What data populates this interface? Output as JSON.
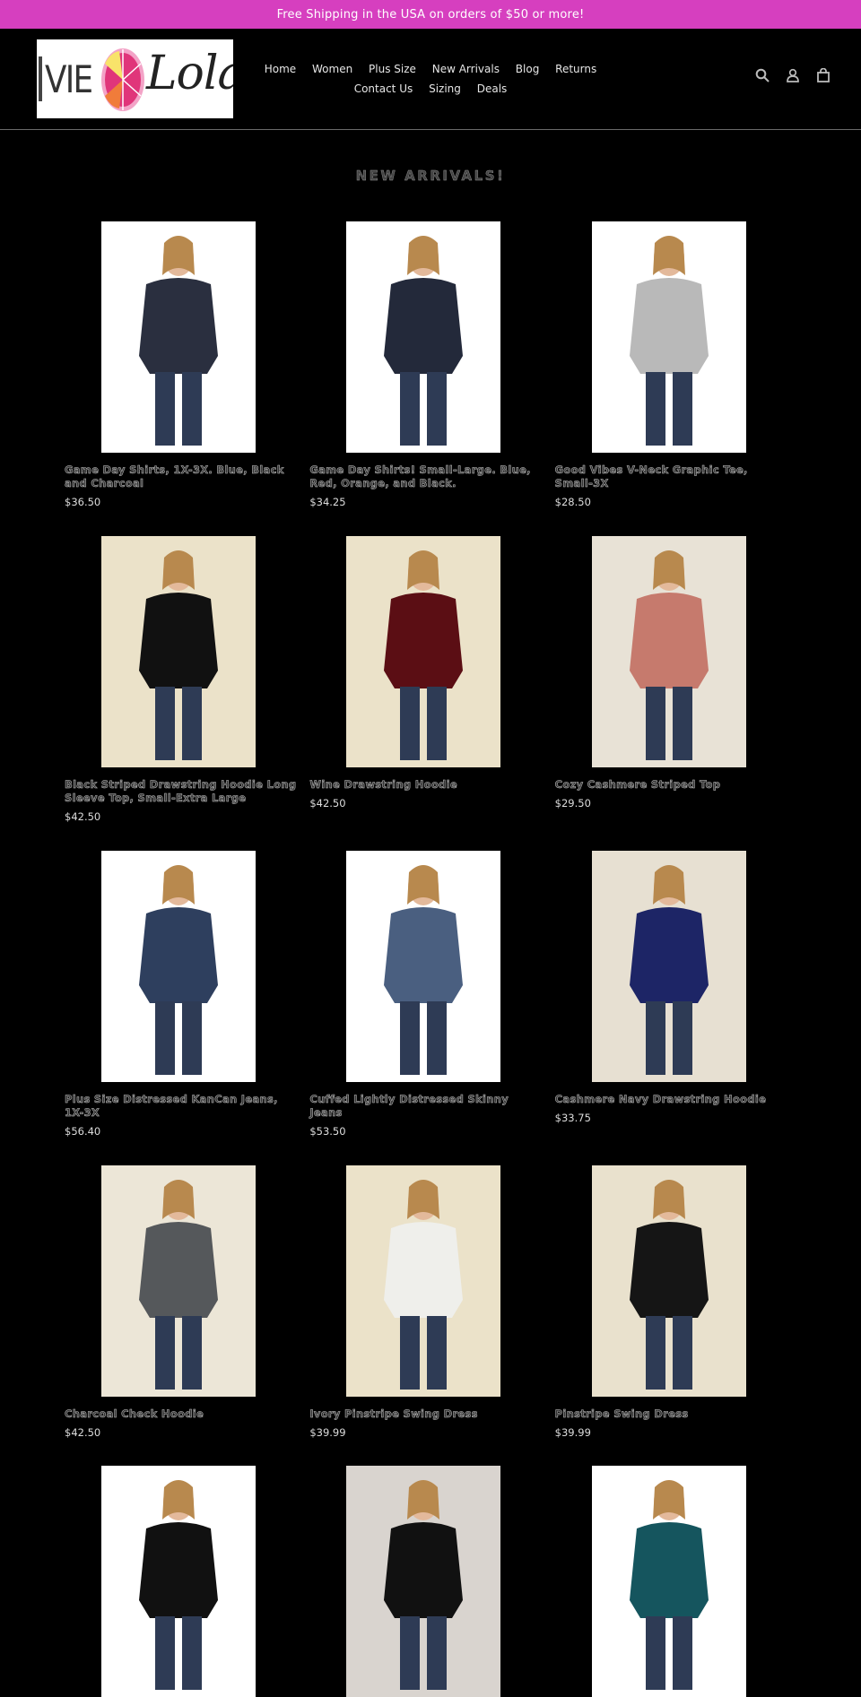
{
  "announcement": "Free Shipping in the USA on orders of $50 or more!",
  "brand": {
    "logo_name": "Ivie Lola logo",
    "logo_text_left": "VIE",
    "logo_text_right": "Lola"
  },
  "nav": [
    "Home",
    "Women",
    "Plus Size",
    "New Arrivals",
    "Blog",
    "Returns",
    "Contact Us",
    "Sizing",
    "Deals"
  ],
  "icons": [
    "search-icon",
    "account-icon",
    "cart-icon"
  ],
  "section_title": "NEW ARRIVALS!",
  "products": [
    {
      "title": "Game Day Shirts, 1X-3X. Blue, Black and Charcoal",
      "price": "$36.50",
      "bg": "#ffffff",
      "garment": "#2a2f3f"
    },
    {
      "title": "Game Day Shirts! Small-Large. Blue, Red, Orange, and Black.",
      "price": "$34.25",
      "bg": "#ffffff",
      "garment": "#23293a"
    },
    {
      "title": "Good Vibes V-Neck Graphic Tee, Small-3X",
      "price": "$28.50",
      "bg": "#ffffff",
      "garment": "#b9b9b9"
    },
    {
      "title": "Black Striped Drawstring Hoodie Long Sleeve Top, Small-Extra Large",
      "price": "$42.50",
      "bg": "#ebe2c9",
      "garment": "#111111"
    },
    {
      "title": "Wine Drawstring Hoodie",
      "price": "$42.50",
      "bg": "#ebe2c9",
      "garment": "#5b0e14"
    },
    {
      "title": "Cozy Cashmere Striped Top",
      "price": "$29.50",
      "bg": "#e8e2d6",
      "garment": "#c67a6d"
    },
    {
      "title": "Plus Size Distressed KanCan Jeans, 1X-3X",
      "price": "$56.40",
      "bg": "#ffffff",
      "garment": "#2e3f5e"
    },
    {
      "title": "Cuffed Lightly Distressed Skinny Jeans",
      "price": "$53.50",
      "bg": "#ffffff",
      "garment": "#4a5f80"
    },
    {
      "title": "Cashmere Navy Drawstring Hoodie",
      "price": "$33.75",
      "bg": "#e7e0d2",
      "garment": "#1d2566"
    },
    {
      "title": "Charcoal Check Hoodie",
      "price": "$42.50",
      "bg": "#ece6d7",
      "garment": "#55585b"
    },
    {
      "title": "Ivory Pinstripe Swing Dress",
      "price": "$39.99",
      "bg": "#ebe2c9",
      "garment": "#efefeb"
    },
    {
      "title": "Pinstripe Swing Dress",
      "price": "$39.99",
      "bg": "#e9e1cd",
      "garment": "#151515"
    },
    {
      "title": "",
      "price": "",
      "bg": "#ffffff",
      "garment": "#111111"
    },
    {
      "title": "",
      "price": "",
      "bg": "#d9d4cf",
      "garment": "#111111"
    },
    {
      "title": "",
      "price": "",
      "bg": "#ffffff",
      "garment": "#15555e"
    }
  ]
}
